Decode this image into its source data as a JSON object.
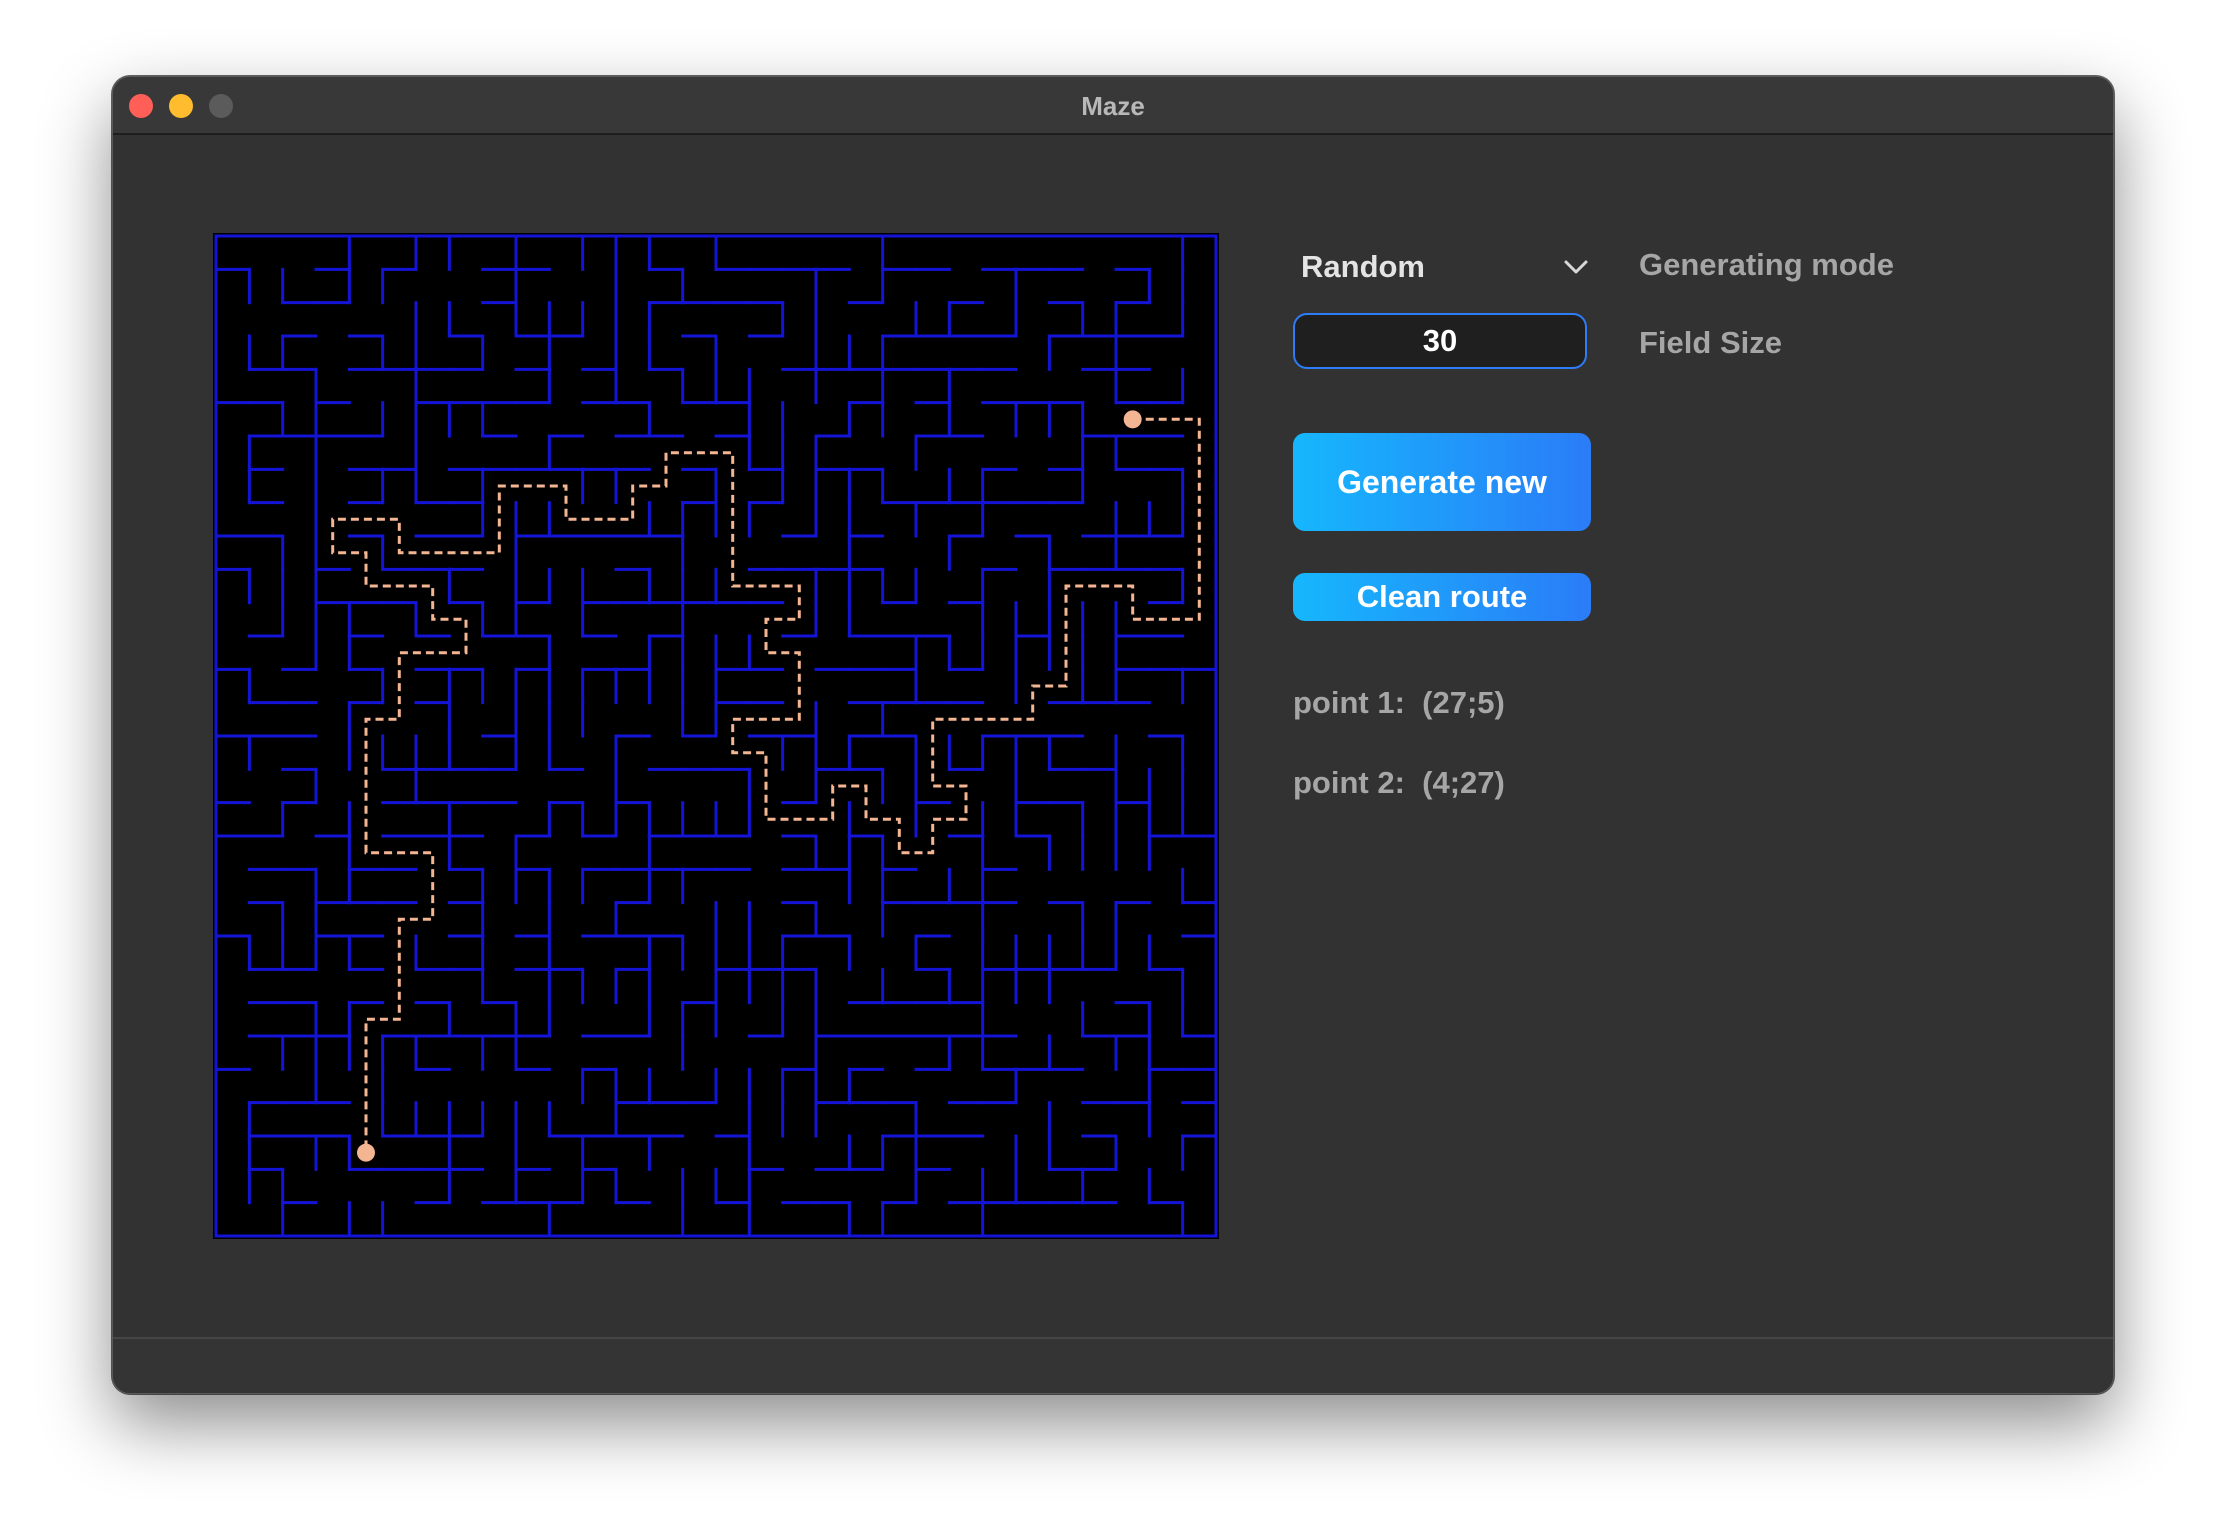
{
  "window": {
    "title": "Maze"
  },
  "controls": {
    "generating_mode": {
      "value": "Random",
      "label": "Generating mode"
    },
    "field_size": {
      "value": "30",
      "label": "Field Size"
    },
    "generate_button": "Generate new",
    "clean_button": "Clean route"
  },
  "points": {
    "point1": "point 1:  (27;5)",
    "point2": "point 2:  (4;27)"
  },
  "maze": {
    "field_size": 30,
    "wall_color": "#1414d8",
    "background_color": "#000000",
    "route_color": "#f4b592",
    "point1": {
      "col": 27,
      "row": 5
    },
    "point2": {
      "col": 4,
      "row": 27
    },
    "route": [
      [
        27,
        5
      ],
      [
        28,
        5
      ],
      [
        29,
        5
      ],
      [
        29,
        6
      ],
      [
        29,
        7
      ],
      [
        29,
        8
      ],
      [
        29,
        9
      ],
      [
        29,
        10
      ],
      [
        29,
        11
      ],
      [
        28,
        11
      ],
      [
        27,
        11
      ],
      [
        27,
        10
      ],
      [
        26,
        10
      ],
      [
        25,
        10
      ],
      [
        25,
        11
      ],
      [
        25,
        12
      ],
      [
        25,
        13
      ],
      [
        24,
        13
      ],
      [
        24,
        14
      ],
      [
        23,
        14
      ],
      [
        22,
        14
      ],
      [
        21,
        14
      ],
      [
        21,
        15
      ],
      [
        21,
        16
      ],
      [
        22,
        16
      ],
      [
        22,
        17
      ],
      [
        21,
        17
      ],
      [
        21,
        18
      ],
      [
        20,
        18
      ],
      [
        20,
        17
      ],
      [
        19,
        17
      ],
      [
        19,
        16
      ],
      [
        18,
        16
      ],
      [
        18,
        17
      ],
      [
        17,
        17
      ],
      [
        16,
        17
      ],
      [
        16,
        16
      ],
      [
        16,
        15
      ],
      [
        15,
        15
      ],
      [
        15,
        14
      ],
      [
        16,
        14
      ],
      [
        17,
        14
      ],
      [
        17,
        13
      ],
      [
        17,
        12
      ],
      [
        16,
        12
      ],
      [
        16,
        11
      ],
      [
        17,
        11
      ],
      [
        17,
        10
      ],
      [
        16,
        10
      ],
      [
        15,
        10
      ],
      [
        15,
        9
      ],
      [
        15,
        8
      ],
      [
        15,
        7
      ],
      [
        15,
        6
      ],
      [
        14,
        6
      ],
      [
        13,
        6
      ],
      [
        13,
        7
      ],
      [
        12,
        7
      ],
      [
        12,
        8
      ],
      [
        11,
        8
      ],
      [
        10,
        8
      ],
      [
        10,
        7
      ],
      [
        9,
        7
      ],
      [
        8,
        7
      ],
      [
        8,
        8
      ],
      [
        8,
        9
      ],
      [
        7,
        9
      ],
      [
        6,
        9
      ],
      [
        5,
        9
      ],
      [
        5,
        8
      ],
      [
        4,
        8
      ],
      [
        3,
        8
      ],
      [
        3,
        9
      ],
      [
        4,
        9
      ],
      [
        4,
        10
      ],
      [
        5,
        10
      ],
      [
        6,
        10
      ],
      [
        6,
        11
      ],
      [
        7,
        11
      ],
      [
        7,
        12
      ],
      [
        6,
        12
      ],
      [
        5,
        12
      ],
      [
        5,
        13
      ],
      [
        5,
        14
      ],
      [
        4,
        14
      ],
      [
        4,
        15
      ],
      [
        4,
        16
      ],
      [
        4,
        17
      ],
      [
        4,
        18
      ],
      [
        5,
        18
      ],
      [
        6,
        18
      ],
      [
        6,
        19
      ],
      [
        6,
        20
      ],
      [
        5,
        20
      ],
      [
        5,
        21
      ],
      [
        5,
        22
      ],
      [
        5,
        23
      ],
      [
        4,
        23
      ],
      [
        4,
        24
      ],
      [
        4,
        25
      ],
      [
        4,
        26
      ],
      [
        4,
        27
      ]
    ]
  }
}
